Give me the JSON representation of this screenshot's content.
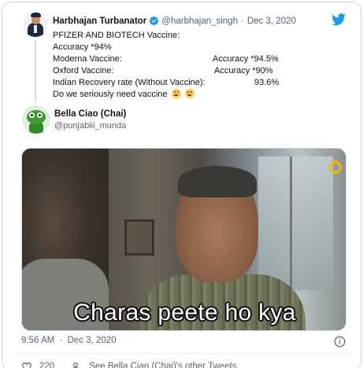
{
  "quoted": {
    "name": "Harbhajan Turbanator",
    "handle": "@harbhajan_singh",
    "separator": "·",
    "date": "Dec 3, 2020",
    "lines": {
      "l1": "PFIZER AND BIOTECH Vaccine:",
      "l2": "Accuracy *94%",
      "l3_left": "Moderna Vaccine:",
      "l3_right": "Accuracy *94.5%",
      "l4_left": "Oxford Vaccine:",
      "l4_right": "Accuracy *90%",
      "l5_left": "Indian Recovery rate (Without Vaccine):",
      "l5_right": "93.6%",
      "l6": "Do we seriously need vaccine"
    },
    "emoji": [
      "thinking-face-emoji",
      "thinking-face-emoji"
    ]
  },
  "reply": {
    "name": "Bella Ciao (Chai)",
    "handle": "@punjabiii_munda",
    "media_caption": "Charas peete ho kya",
    "time": "9:56 AM",
    "separator": "·",
    "date": "Dec 3, 2020"
  },
  "footer": {
    "likes": "220",
    "see_other": "See Bella Ciao (Chai)'s other Tweets"
  },
  "colors": {
    "brand": "#1d9bf0",
    "secondary_text": "#536471",
    "border": "#cfd9de"
  }
}
